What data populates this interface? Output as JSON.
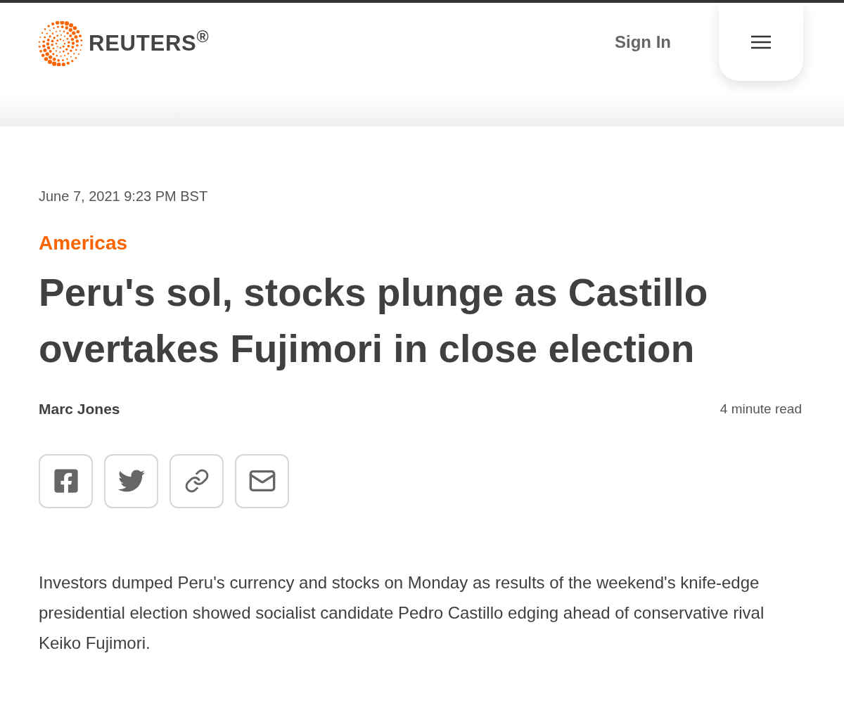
{
  "header": {
    "logo_text": "REUTERS$^{®}$",
    "sign_in": "Sign In"
  },
  "article": {
    "date": "June 7, 2021 9:23 PM BST",
    "section": "Americas",
    "headline": "Peru's sol, stocks plunge as Castillo overtakes Fujimori in close election",
    "author": "Marc Jones",
    "read_time": "4 minute read",
    "share": [
      {
        "kind": "facebook"
      },
      {
        "kind": "twitter"
      },
      {
        "kind": "link"
      },
      {
        "kind": "email"
      }
    ],
    "paragraph": "Investors dumped Peru's currency and stocks on Monday as results of the weekend's knife-edge presidential election showed socialist candidate Pedro Castillo edging ahead of conservative rival Keiko Fujimori."
  }
}
